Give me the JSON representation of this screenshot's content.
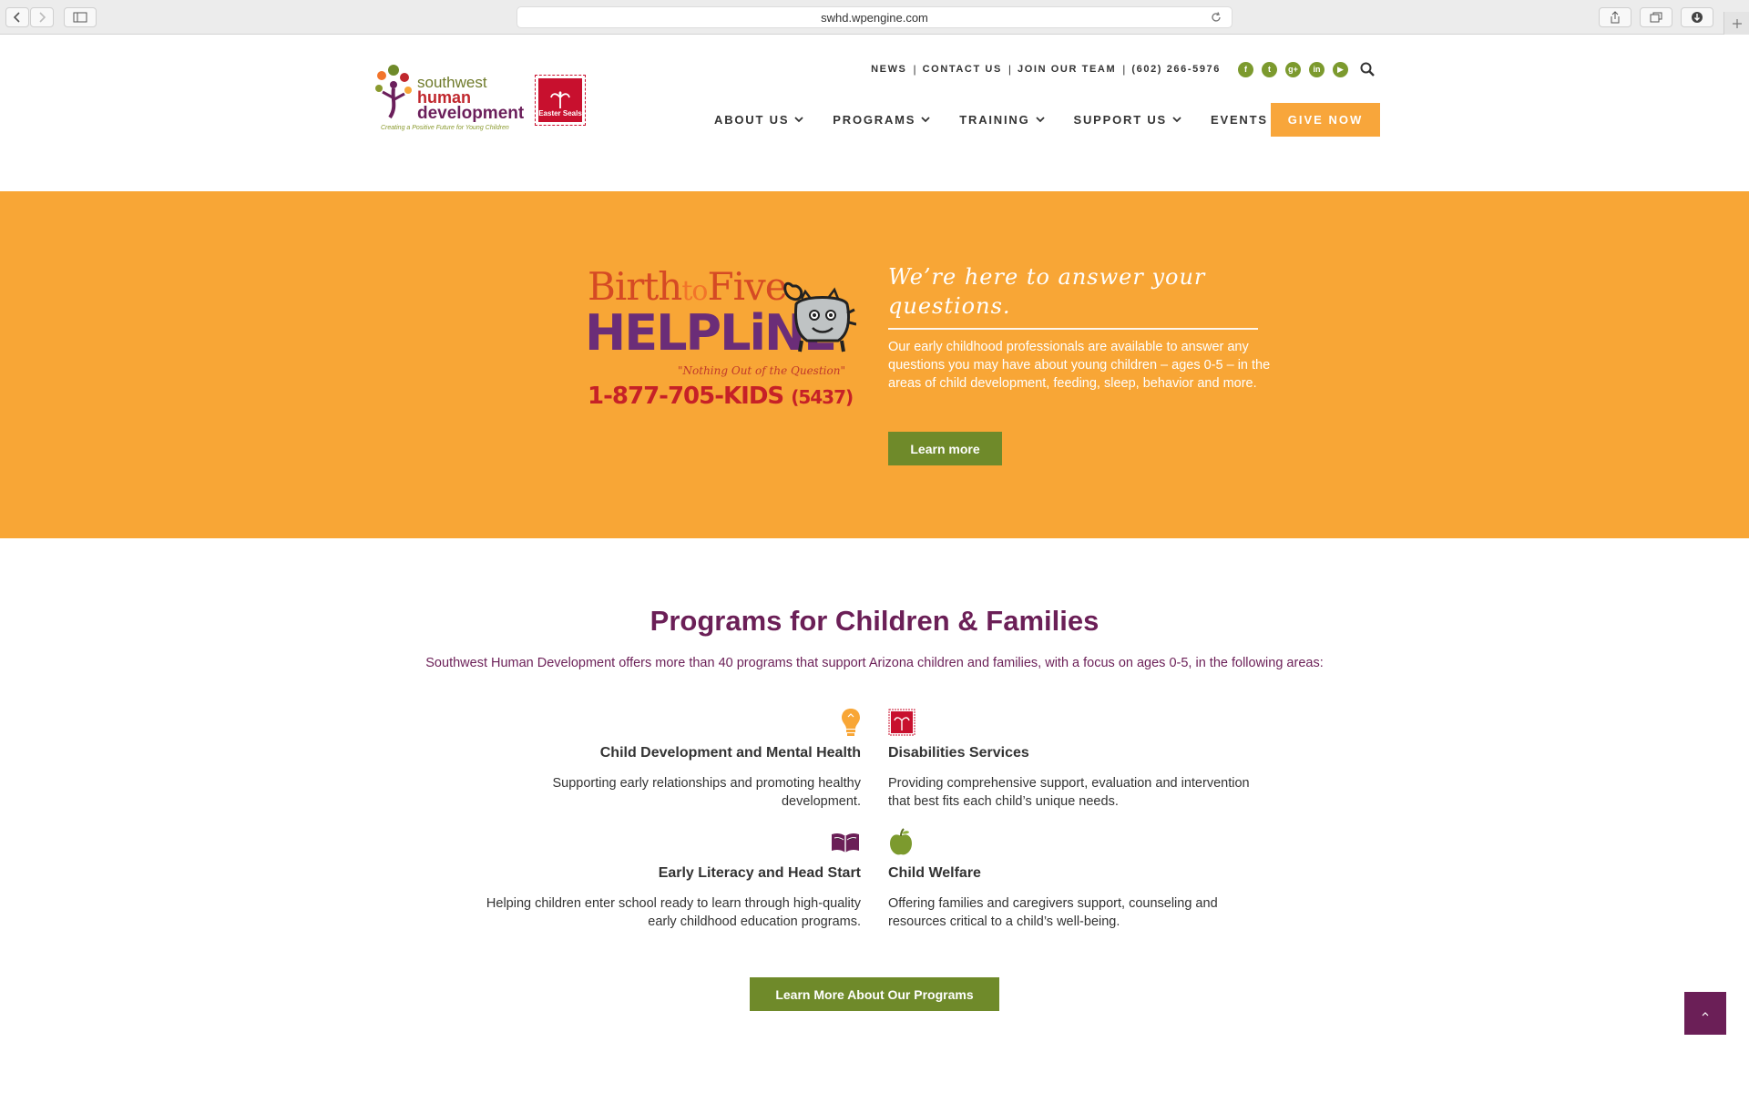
{
  "browser": {
    "url": "swhd.wpengine.com"
  },
  "logo": {
    "line1": "southwest",
    "line2": "human",
    "line3": "development",
    "tagline": "Creating a Positive Future for Young Children",
    "partner": "Easter Seals"
  },
  "topbar": {
    "links": [
      "NEWS",
      "CONTACT US",
      "JOIN OUR TEAM",
      "(602) 266-5976"
    ],
    "social": [
      "f",
      "t",
      "g+",
      "in",
      "▶"
    ]
  },
  "nav": {
    "items": [
      "ABOUT US",
      "PROGRAMS",
      "TRAINING",
      "SUPPORT US",
      "EVENTS"
    ],
    "give": "GIVE NOW"
  },
  "hero": {
    "helpline_top": "Birth",
    "helpline_to": "to",
    "helpline_five": "Five",
    "helpline_main": "HELPLiNE",
    "helpline_tagline": "\"Nothing Out of the Question\"",
    "helpline_phone": "1-877-705-KIDS",
    "helpline_phone_digits": "(5437)",
    "heading": "We’re here to answer your questions.",
    "body": "Our early childhood professionals are available to answer any questions you may have about young children – ages 0-5 – in the areas of child development, feeding, sleep, behavior and more.",
    "button": "Learn more"
  },
  "programs": {
    "title": "Programs for Children & Families",
    "intro": "Southwest Human Development offers more than 40 programs that support Arizona children and families, with a focus on ages 0-5, in the following areas:",
    "items": [
      {
        "title": "Child Development and Mental Health",
        "desc": "Supporting early relationships and promoting healthy development.",
        "icon": "lightbulb-icon"
      },
      {
        "title": "Disabilities Services",
        "desc": "Providing comprehensive support, evaluation and intervention that best fits each child’s unique needs.",
        "icon": "easter-seals-icon"
      },
      {
        "title": "Early Literacy and Head Start",
        "desc": "Helping children enter school ready to learn through high-quality early childhood education programs.",
        "icon": "book-icon"
      },
      {
        "title": "Child Welfare",
        "desc": "Offering families and caregivers support, counseling and resources critical to a child’s well-being.",
        "icon": "apple-icon"
      }
    ],
    "button": "Learn More About Our Programs"
  },
  "colors": {
    "orange": "#f8a636",
    "green": "#6f8a2a",
    "purple": "#6b1f57"
  }
}
